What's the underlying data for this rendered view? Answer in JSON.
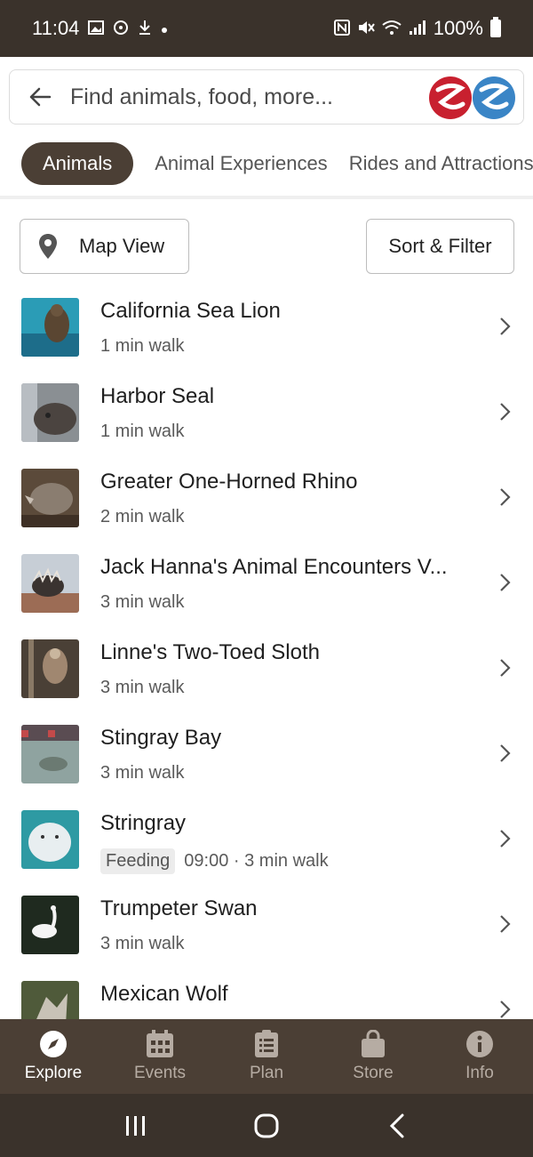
{
  "status_bar": {
    "time": "11:04",
    "battery_percent": "100%",
    "icons": [
      "image-icon",
      "sync-icon",
      "download-icon",
      "dot-icon",
      "nfc-icon",
      "mute-icon",
      "wifi-icon",
      "signal-icon",
      "battery-icon"
    ]
  },
  "search": {
    "placeholder": "Find animals, food, more...",
    "logo_icon": "zoo-logo-icon"
  },
  "tabs": [
    {
      "label": "Animals",
      "active": true
    },
    {
      "label": "Animal Experiences",
      "active": false
    },
    {
      "label": "Rides and Attractions",
      "active": false
    }
  ],
  "actions": {
    "map_view_label": "Map View",
    "sort_filter_label": "Sort & Filter"
  },
  "animals": [
    {
      "name": "California Sea Lion",
      "walk": "1 min walk"
    },
    {
      "name": "Harbor Seal",
      "walk": "1 min walk"
    },
    {
      "name": "Greater One-Horned Rhino",
      "walk": "2 min walk"
    },
    {
      "name": "Jack Hanna's Animal Encounters V...",
      "walk": "3 min walk"
    },
    {
      "name": "Linne's Two-Toed Sloth",
      "walk": "3 min walk"
    },
    {
      "name": "Stingray Bay",
      "walk": "3 min walk"
    },
    {
      "name": "Stringray",
      "badge": "Feeding",
      "walk": "09:00 · 3 min walk"
    },
    {
      "name": "Trumpeter Swan",
      "walk": "3 min walk"
    },
    {
      "name": "Mexican Wolf",
      "walk": ""
    }
  ],
  "bottom_nav": [
    {
      "label": "Explore",
      "icon": "compass-icon",
      "active": true
    },
    {
      "label": "Events",
      "icon": "calendar-icon",
      "active": false
    },
    {
      "label": "Plan",
      "icon": "clipboard-icon",
      "active": false
    },
    {
      "label": "Store",
      "icon": "shopping-bag-icon",
      "active": false
    },
    {
      "label": "Info",
      "icon": "info-icon",
      "active": false
    }
  ],
  "colors": {
    "status_bar": "#3a322b",
    "nav_bar": "#4b3f35",
    "active_tab": "#4b3f35",
    "logo_red": "#c8202f",
    "logo_blue": "#3a85c6"
  }
}
